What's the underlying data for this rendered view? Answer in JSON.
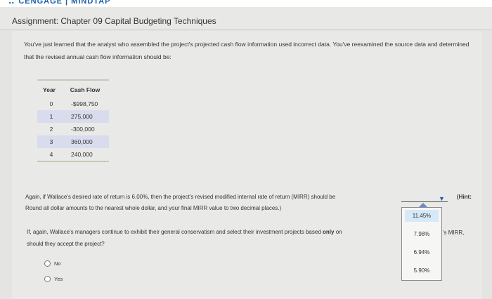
{
  "header": {
    "brand": "CENGAGE | MINDTAP",
    "assignment_title": "Assignment: Chapter 09 Capital Budgeting Techniques"
  },
  "intro": "You've just learned that the analyst who assembled the project's projected cash flow information used incorrect data. You've reexamined the source data and determined that the revised annual cash flow information should be:",
  "cash_flow_table": {
    "headers": [
      "Year",
      "Cash Flow"
    ],
    "rows": [
      {
        "year": "0",
        "cash_flow": "-$998,750"
      },
      {
        "year": "1",
        "cash_flow": "275,000"
      },
      {
        "year": "2",
        "cash_flow": "-300,000"
      },
      {
        "year": "3",
        "cash_flow": "360,000"
      },
      {
        "year": "4",
        "cash_flow": "240,000"
      }
    ]
  },
  "question1": {
    "text": "Again, if Wallace's desired rate of return is 6.00%, then the project's revised modified internal rate of return (MIRR) should be",
    "hint": "(Hint:",
    "note": "Round all dollar amounts to the nearest whole dollar, and your final MIRR value to two decimal places.)"
  },
  "mirr_dropdown": {
    "options": [
      "11.45%",
      "7.98%",
      "6.94%",
      "5.90%"
    ],
    "highlighted": "11.45%"
  },
  "question2": {
    "text_before_bold": "If, again, Wallace's managers continue to exhibit their general conservatism and select their investment projects based ",
    "bold": "only",
    "text_after_bold": " on",
    "tail": "'s MIRR,",
    "line2": "should they accept the project?"
  },
  "answer_choices": [
    "No",
    "Yes"
  ]
}
